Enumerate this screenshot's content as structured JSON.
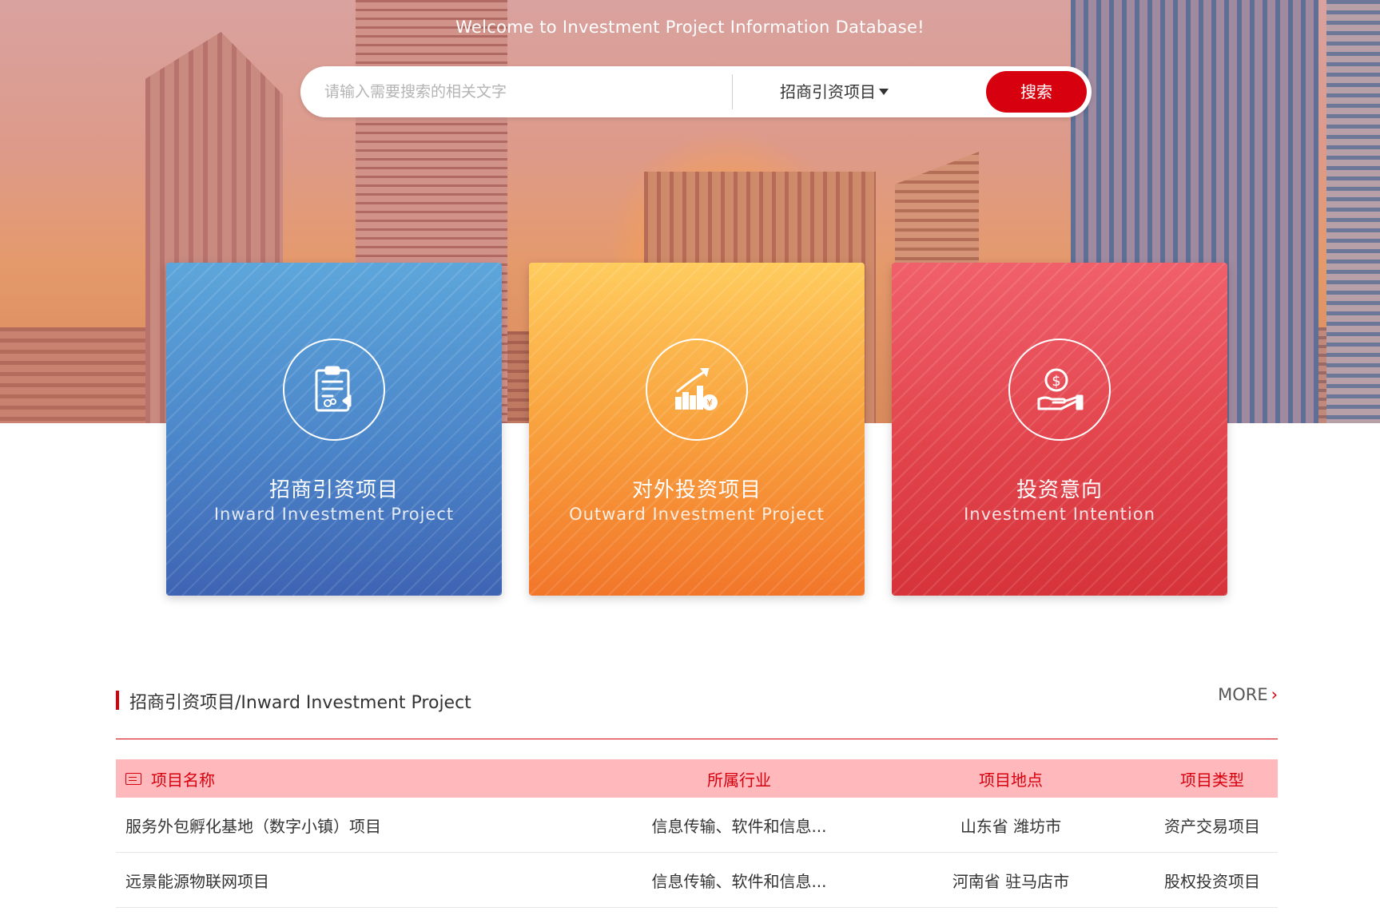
{
  "hero": {
    "welcome": "Welcome to Investment Project Information Database!",
    "search": {
      "placeholder": "请输入需要搜索的相关文字",
      "category": "招商引资项目",
      "button": "搜索"
    }
  },
  "cards": [
    {
      "title_cn": "招商引资项目",
      "title_en": "Inward Investment Project",
      "icon": "clipboard-icon"
    },
    {
      "title_cn": "对外投资项目",
      "title_en": "Outward Investment Project",
      "icon": "growth-chart-icon"
    },
    {
      "title_cn": "投资意向",
      "title_en": "Investment Intention",
      "icon": "money-hand-icon"
    }
  ],
  "section": {
    "title": "招商引资项目/Inward Investment Project",
    "more": "MORE",
    "columns": [
      "项目名称",
      "所属行业",
      "项目地点",
      "项目类型"
    ],
    "rows": [
      {
        "name": "服务外包孵化基地（数字小镇）项目",
        "industry": "信息传输、软件和信息...",
        "location": "山东省 潍坊市",
        "type": "资产交易项目"
      },
      {
        "name": "远景能源物联网项目",
        "industry": "信息传输、软件和信息...",
        "location": "河南省 驻马店市",
        "type": "股权投资项目"
      }
    ]
  },
  "colors": {
    "accent": "#d7000f",
    "header_bg": "#ffb8bb",
    "card_blue": "#4b85c9",
    "card_orange": "#f9a540",
    "card_red": "#e2444c"
  }
}
